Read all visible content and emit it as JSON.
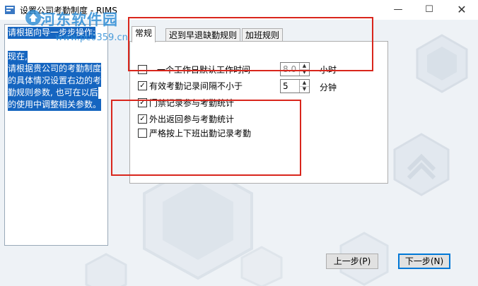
{
  "window": {
    "title": "设置公司考勤制度 - RIMS",
    "minimize_icon": "minimize-icon",
    "maximize_icon": "maximize-icon",
    "close_icon": "close-icon"
  },
  "watermark": {
    "brand": "河东软件园",
    "url": "www.pc0359.cn"
  },
  "guide": {
    "lines": [
      "请根据向导一步步操作:",
      "现在,",
      "请根据贵公司的考勤制度",
      "的具体情况设置右边的考",
      "勤规则参数, 也可在以后",
      "的使用中调整相关参数。"
    ]
  },
  "tabs": [
    {
      "label": "常规",
      "active": true
    },
    {
      "label": "迟到早退缺勤规则",
      "active": false
    },
    {
      "label": "加班规则",
      "active": false
    }
  ],
  "general": {
    "workday_hours": {
      "label": "一个工作日默认工作时间",
      "checked": false,
      "value": "8.0",
      "unit": "小时"
    },
    "min_interval": {
      "label": "有效考勤记录间隔不小于",
      "checked": true,
      "value": "5",
      "unit": "分钟"
    },
    "access_control": {
      "label": "门禁记录参与考勤统计",
      "checked": true
    },
    "outing": {
      "label": "外出返回参与考勤统计",
      "checked": true
    },
    "strict": {
      "label": "严格按上下班出勤记录考勤",
      "checked": false
    }
  },
  "buttons": {
    "prev": "上一步(P)",
    "next": "下一步(N)"
  },
  "colors": {
    "highlight": "#1565c0",
    "annotation": "#d9261c",
    "watermark": "#2d8dd6"
  }
}
